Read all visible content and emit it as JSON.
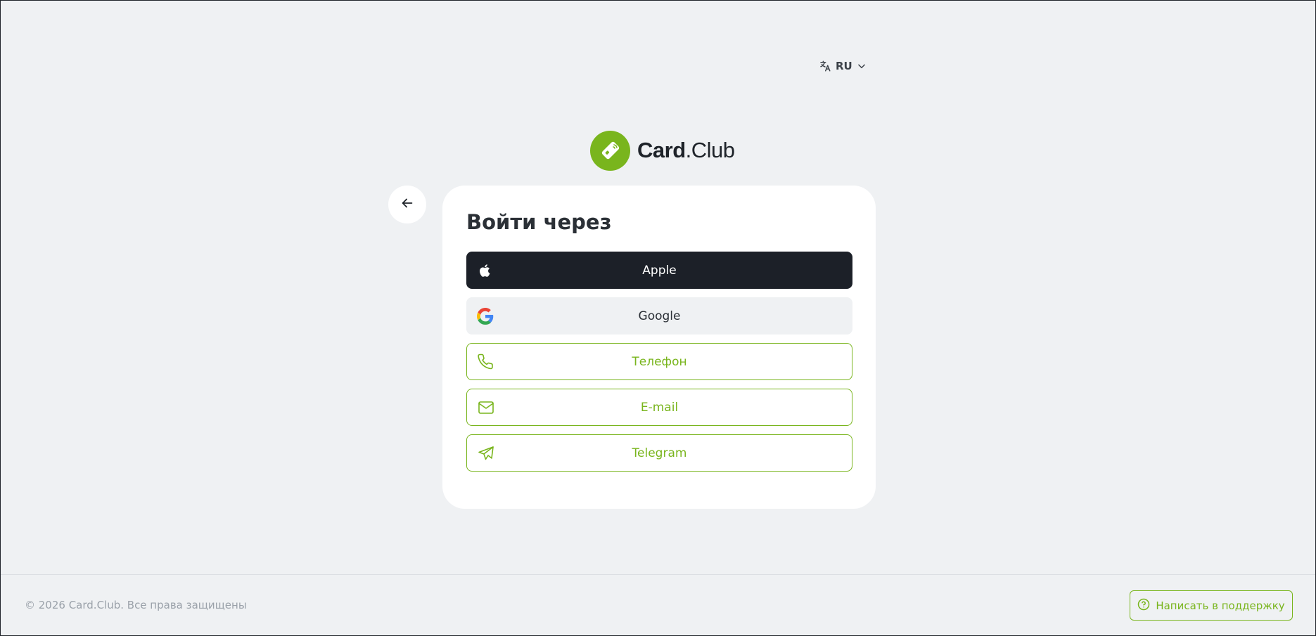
{
  "language": {
    "current": "RU",
    "icon": "translate-icon"
  },
  "logo": {
    "brand_bold": "Card",
    "brand_light": ".Club"
  },
  "login": {
    "title": "Войти через",
    "options": [
      {
        "label": "Apple",
        "icon": "apple-icon"
      },
      {
        "label": "Google",
        "icon": "google-icon"
      },
      {
        "label": "Телефон",
        "icon": "phone-icon"
      },
      {
        "label": "E-mail",
        "icon": "mail-icon"
      },
      {
        "label": "Telegram",
        "icon": "telegram-icon"
      }
    ]
  },
  "footer": {
    "copyright": "© 2026 Card.Club. Все права защищены",
    "support_label": "Написать в поддержку"
  },
  "colors": {
    "accent": "#79b51d",
    "background": "#eff1f3",
    "apple_button": "#1c2028"
  }
}
